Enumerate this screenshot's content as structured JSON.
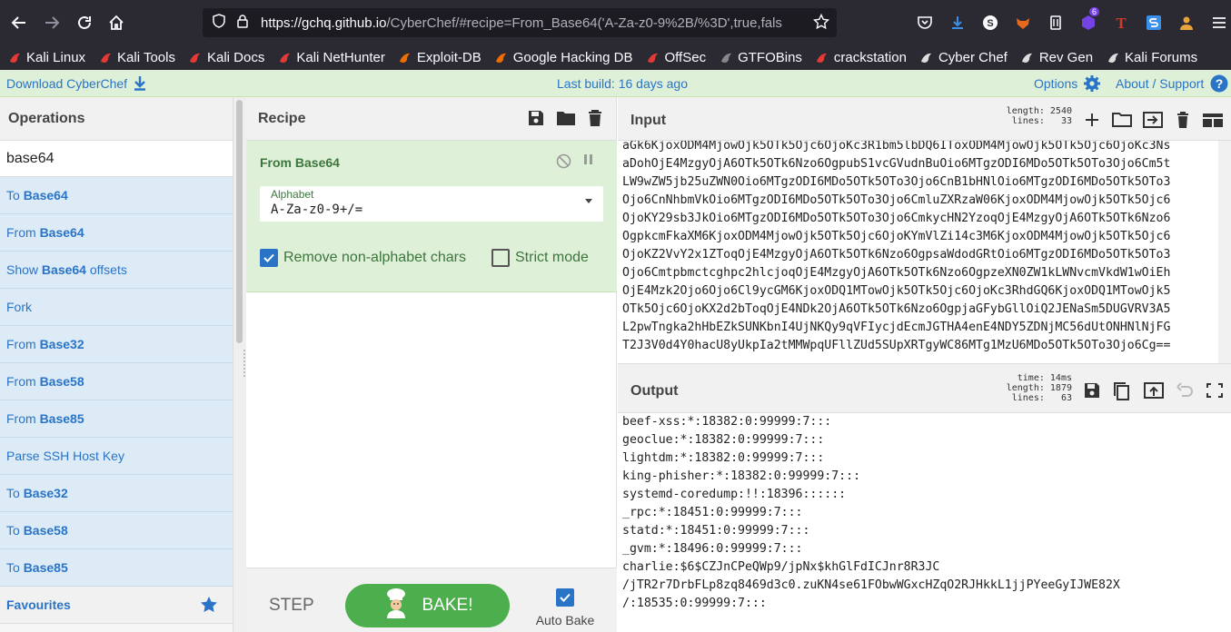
{
  "browser": {
    "url_host": "https://gchq.github.io",
    "url_rest": "/CyberChef/#recipe=From_Base64('A-Za-z0-9%2B/%3D',true,fals",
    "ext_badge": "6",
    "bookmarks": [
      {
        "label": "Kali Linux",
        "icon": "kali-dragon-icon",
        "color": "#e53935"
      },
      {
        "label": "Kali Tools",
        "icon": "kali-dragon-icon",
        "color": "#e53935"
      },
      {
        "label": "Kali Docs",
        "icon": "kali-docs-icon",
        "color": "#e53935"
      },
      {
        "label": "Kali NetHunter",
        "icon": "kali-dragon-icon",
        "color": "#e53935"
      },
      {
        "label": "Exploit-DB",
        "icon": "exploitdb-icon",
        "color": "#ef6c00"
      },
      {
        "label": "Google Hacking DB",
        "icon": "ghdb-icon",
        "color": "#ef6c00"
      },
      {
        "label": "OffSec",
        "icon": "offsec-icon",
        "color": "#e53935"
      },
      {
        "label": "GTFOBins",
        "icon": "gtfobins-icon",
        "color": "#888888"
      },
      {
        "label": "crackstation",
        "icon": "crackstation-icon",
        "color": "#e53935"
      },
      {
        "label": "Cyber Chef",
        "icon": "chef-hat-icon",
        "color": "#dddddd"
      },
      {
        "label": "Rev Gen",
        "icon": "skull-icon",
        "color": "#dddddd"
      },
      {
        "label": "Kali Forums",
        "icon": "kali-dragon-icon",
        "color": "#dddddd"
      }
    ]
  },
  "banner": {
    "download": "Download CyberChef",
    "last_build": "Last build: 16 days ago",
    "options": "Options",
    "about": "About / Support"
  },
  "operations": {
    "title": "Operations",
    "search_value": "base64",
    "items": [
      {
        "prefix": "To ",
        "match": "Base64",
        "suffix": ""
      },
      {
        "prefix": "From ",
        "match": "Base64",
        "suffix": ""
      },
      {
        "prefix": "Show ",
        "match": "Base64",
        "suffix": " offsets"
      },
      {
        "prefix": "Fork",
        "match": "",
        "suffix": ""
      },
      {
        "prefix": "From ",
        "match": "Base",
        "suffix": "32"
      },
      {
        "prefix": "From ",
        "match": "Base",
        "suffix": "58"
      },
      {
        "prefix": "From ",
        "match": "Base",
        "suffix": "85"
      },
      {
        "prefix": "Parse SSH Host Key",
        "match": "",
        "suffix": ""
      },
      {
        "prefix": "To ",
        "match": "Base",
        "suffix": "32"
      },
      {
        "prefix": "To ",
        "match": "Base",
        "suffix": "58"
      },
      {
        "prefix": "To ",
        "match": "Base",
        "suffix": "85"
      }
    ],
    "favourites": "Favourites"
  },
  "recipe": {
    "title": "Recipe",
    "operation": "From Base64",
    "alphabet_label": "Alphabet",
    "alphabet_value": "A-Za-z0-9+/=",
    "remove_nonalpha": "Remove non-alphabet chars",
    "strict_mode": "Strict mode",
    "step": "STEP",
    "bake": "BAKE!",
    "auto_bake": "Auto Bake"
  },
  "input": {
    "title": "Input",
    "length_label": "length:",
    "length": "2540",
    "lines_label": "lines:",
    "lines": "33",
    "text": [
      "aGk6KjoxODM4MjowOjk5OTk5Ojc6OjoKc3R1bm5lbDQ6IToxODM4MjowOjk5OTk5Ojc6OjoKc3Ns",
      "aDohOjE4MzgyOjA6OTk5OTk6Nzo6OgpubS1vcGVudnBuOio6MTgzODI6MDo5OTk5OTo3Ojo6Cm5t",
      "LW9wZW5jb25uZWN0Oio6MTgzODI6MDo5OTk5OTo3Ojo6CnB1bHNlOio6MTgzODI6MDo5OTk5OTo3",
      "Ojo6CnNhbmVkOio6MTgzODI6MDo5OTk5OTo3Ojo6CmluZXRzaW06KjoxODM4MjowOjk5OTk5Ojc6",
      "OjoKY29sb3JkOio6MTgzODI6MDo5OTk5OTo3Ojo6CmkycHN2YzoqOjE4MzgyOjA6OTk5OTk6Nzo6",
      "OgpkcmFkaXM6KjoxODM4MjowOjk5OTk5Ojc6OjoKYmVlZi14c3M6KjoxODM4MjowOjk5OTk5Ojc6",
      "OjoKZ2VvY2x1ZToqOjE4MzgyOjA6OTk5OTk6Nzo6OgpsaWdodGRtOio6MTgzODI6MDo5OTk5OTo3",
      "Ojo6Cmtpbmctcghpc2hlcjoqOjE4MzgyOjA6OTk5OTk6Nzo6OgpzeXN0ZW1kLWNvcmVkdW1wOiEh",
      "OjE4Mzk2Ojo6Ojo6Cl9ycGM6KjoxODQ1MTowOjk5OTk5Ojc6OjoKc3RhdGQ6KjoxODQ1MTowOjk5",
      "OTk5Ojc6OjoKX2d2bToqOjE4NDk2OjA6OTk5OTk6Nzo6OgpjaGFybGllOiQ2JENaSm5DUGVRV3A5",
      "L2pwTngka2hHbEZkSUNKbnI4UjNKQy9qVFIycjdEcmJGTHA4enE4NDY5ZDNjMC56dUtONHNlNjFG",
      "T2J3V0d4Y0hacU8yUkpIa2tMMWpqUFllZUd5SUpXRTgyWC86MTg1MzU6MDo5OTk5OTo3Ojo6Cg=="
    ]
  },
  "output": {
    "title": "Output",
    "time_label": "time:",
    "time": "14ms",
    "length_label": "length:",
    "length": "1879",
    "lines_label": "lines:",
    "lines": "63",
    "text": [
      "beef-xss:*:18382:0:99999:7:::",
      "geoclue:*:18382:0:99999:7:::",
      "lightdm:*:18382:0:99999:7:::",
      "king-phisher:*:18382:0:99999:7:::",
      "systemd-coredump:!!:18396::::::",
      "_rpc:*:18451:0:99999:7:::",
      "statd:*:18451:0:99999:7:::",
      "_gvm:*:18496:0:99999:7:::",
      "charlie:$6$CZJnCPeQWp9/jpNx$khGlFdICJnr8R3JC",
      "/jTR2r7DrbFLp8zq8469d3c0.zuKN4se61FObwWGxcHZqO2RJHkkL1jjPYeeGyIJWE82X",
      "/:18535:0:99999:7:::"
    ]
  },
  "colors": {
    "accent_blue": "#2a74c7",
    "bake_green": "#4cae4c",
    "recipe_green_bg": "#dff0d8",
    "ops_item_bg": "#dcebf6"
  }
}
